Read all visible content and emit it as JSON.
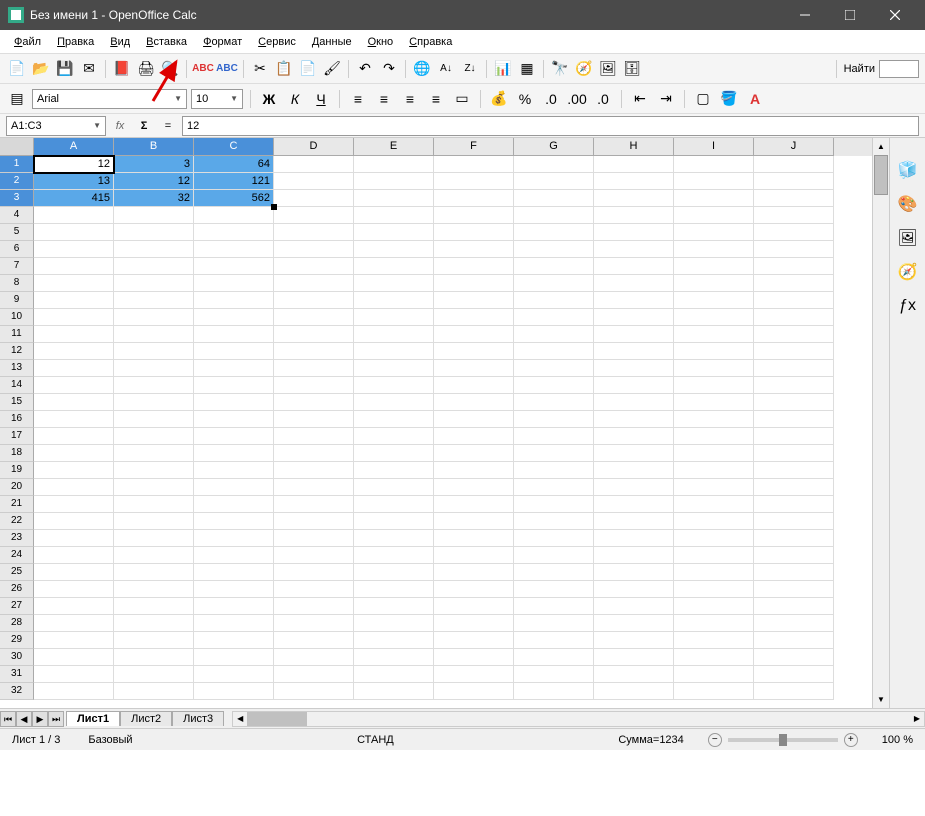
{
  "window": {
    "title": "Без имени 1 - OpenOffice Calc"
  },
  "menubar": {
    "items": [
      "Файл",
      "Правка",
      "Вид",
      "Вставка",
      "Формат",
      "Сервис",
      "Данные",
      "Окно",
      "Справка"
    ]
  },
  "find": {
    "label": "Найти",
    "placeholder": ""
  },
  "font": {
    "name": "Arial",
    "size": "10"
  },
  "formula_bar": {
    "name_box": "A1:C3",
    "formula": "12",
    "fx_label": "fx",
    "sum_label": "Σ",
    "eq_label": "="
  },
  "columns": [
    "A",
    "B",
    "C",
    "D",
    "E",
    "F",
    "G",
    "H",
    "I",
    "J"
  ],
  "selected_cols": [
    "A",
    "B",
    "C"
  ],
  "selected_rows": [
    1,
    2,
    3
  ],
  "active_cell": "A1",
  "row_count": 32,
  "cells": {
    "A1": "12",
    "B1": "3",
    "C1": "64",
    "A2": "13",
    "B2": "12",
    "C2": "121",
    "A3": "415",
    "B3": "32",
    "C3": "562"
  },
  "sheets": {
    "active": 0,
    "tabs": [
      "Лист1",
      "Лист2",
      "Лист3"
    ]
  },
  "statusbar": {
    "sheet_pos": "Лист 1 / 3",
    "style": "Базовый",
    "mode": "СТАНД",
    "sum": "Сумма=1234",
    "zoom": "100 %"
  },
  "format_buttons": {
    "bold": "Ж",
    "italic": "К",
    "underline": "Ч"
  }
}
